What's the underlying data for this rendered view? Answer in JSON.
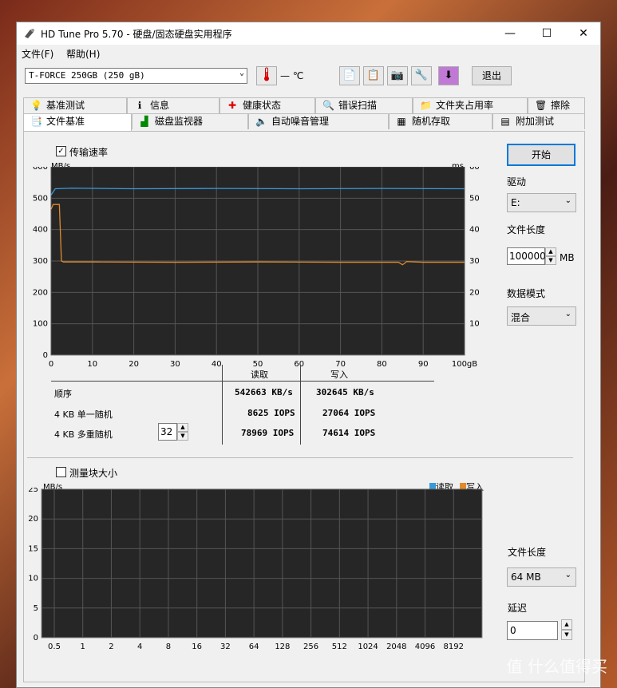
{
  "window": {
    "title": "HD Tune Pro 5.70 - 硬盘/固态硬盘实用程序",
    "min": "—",
    "max": "☐",
    "close": "✕"
  },
  "menu": [
    "文件(F)",
    "帮助(H)"
  ],
  "toolbar": {
    "drive": "T-FORCE 250GB (250 gB)",
    "temp": "— ℃",
    "exit": "退出"
  },
  "tabs_row1": [
    "基准测试",
    "信息",
    "健康状态",
    "错误扫描",
    "文件夹占用率",
    "擦除"
  ],
  "tabs_row2": [
    "文件基准",
    "磁盘监视器",
    "自动噪音管理",
    "随机存取",
    "附加测试"
  ],
  "panel": {
    "transfer_cb": "传输速率",
    "transfer_checked": "✓",
    "chart1": {
      "y_unit_left": "MB/s",
      "y_unit_right": "ms"
    },
    "results": {
      "hdr_read": "读取",
      "hdr_write": "写入",
      "rows": [
        {
          "label": "顺序",
          "read": "542663 KB/s",
          "write": "302645 KB/s"
        },
        {
          "label": "4 KB 单一随机",
          "read": "8625 IOPS",
          "write": "27064 IOPS"
        },
        {
          "label": "4 KB 多重随机",
          "read": "78969 IOPS",
          "write": "74614 IOPS"
        }
      ],
      "queue": "32"
    },
    "blocksize_cb": "测量块大小",
    "chart2": {
      "y_unit": "MB/s",
      "legend_read": "读取",
      "legend_write": "写入"
    },
    "start": "开始",
    "drive_lbl": "驱动",
    "drive_val": "E:",
    "flen_lbl": "文件长度",
    "flen_val": "100000",
    "flen_unit": "MB",
    "mode_lbl": "数据模式",
    "mode_val": "混合",
    "flen2_lbl": "文件长度",
    "flen2_val": "64 MB",
    "delay_lbl": "延迟",
    "delay_val": "0"
  },
  "watermark": "值 什么值得买",
  "chart_data": [
    {
      "type": "line",
      "x_ticks": [
        "0",
        "10",
        "20",
        "30",
        "40",
        "50",
        "60",
        "70",
        "80",
        "90",
        "100gB"
      ],
      "y_left_ticks": [
        "100",
        "200",
        "300",
        "400",
        "500",
        "600"
      ],
      "y_right_ticks": [
        "10",
        "20",
        "30",
        "40",
        "50",
        "60"
      ],
      "xlabel": "",
      "ylabel_left": "MB/s",
      "ylabel_right": "ms",
      "ylim": [
        0,
        600
      ],
      "xlim": [
        0,
        100
      ],
      "series": [
        {
          "name": "读取",
          "color": "#3a9ad9",
          "x": [
            0,
            1,
            5,
            20,
            40,
            60,
            80,
            100
          ],
          "values": [
            510,
            530,
            532,
            530,
            531,
            530,
            531,
            530
          ]
        },
        {
          "name": "写入",
          "color": "#e08a2c",
          "x": [
            0,
            0.5,
            2,
            2.5,
            3,
            10,
            30,
            50,
            70,
            84,
            85,
            86,
            90,
            100
          ],
          "values": [
            465,
            480,
            480,
            300,
            297,
            297,
            296,
            297,
            296,
            296,
            288,
            298,
            296,
            296
          ]
        }
      ]
    },
    {
      "type": "bar",
      "categories": [
        "0.5",
        "1",
        "2",
        "4",
        "8",
        "16",
        "32",
        "64",
        "128",
        "256",
        "512",
        "1024",
        "2048",
        "4096",
        "8192"
      ],
      "y_ticks": [
        "5",
        "10",
        "15",
        "20",
        "25"
      ],
      "ylabel": "MB/s",
      "ylim": [
        0,
        25
      ],
      "series": [
        {
          "name": "读取",
          "color": "#3a9ad9",
          "values": []
        },
        {
          "name": "写入",
          "color": "#e08a2c",
          "values": []
        }
      ]
    }
  ]
}
